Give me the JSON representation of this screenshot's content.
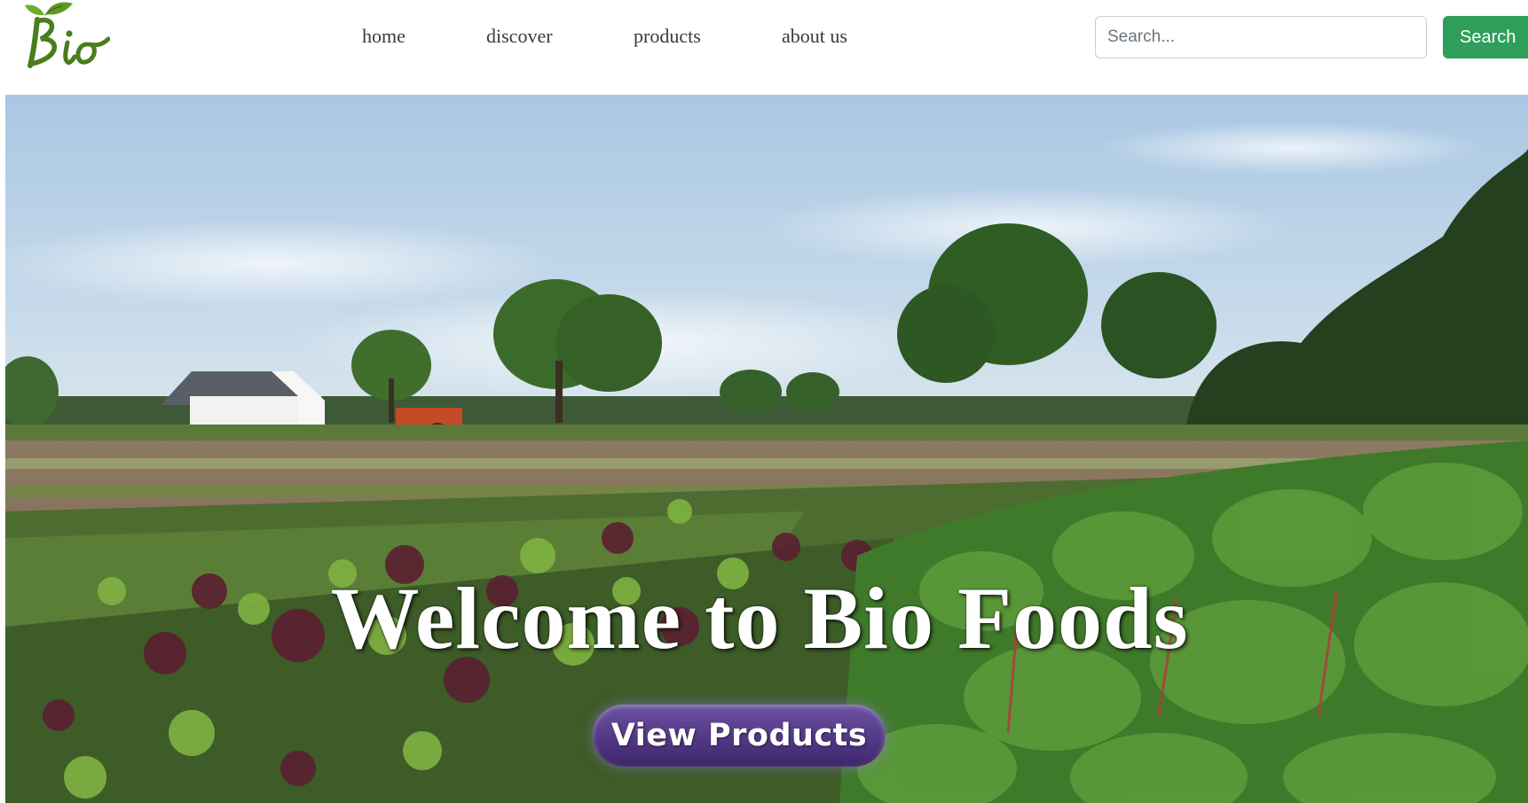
{
  "brand": {
    "logo_text": "Bio",
    "color": "#4a7d1c"
  },
  "nav": {
    "items": [
      {
        "label": "home"
      },
      {
        "label": "discover"
      },
      {
        "label": "products"
      },
      {
        "label": "about us"
      }
    ]
  },
  "search": {
    "placeholder": "Search...",
    "value": "",
    "button_label": "Search",
    "button_color": "#2f9e5b"
  },
  "hero": {
    "title": "Welcome to Bio Foods",
    "cta_label": "View Products",
    "cta_color": "#4b2c86"
  }
}
